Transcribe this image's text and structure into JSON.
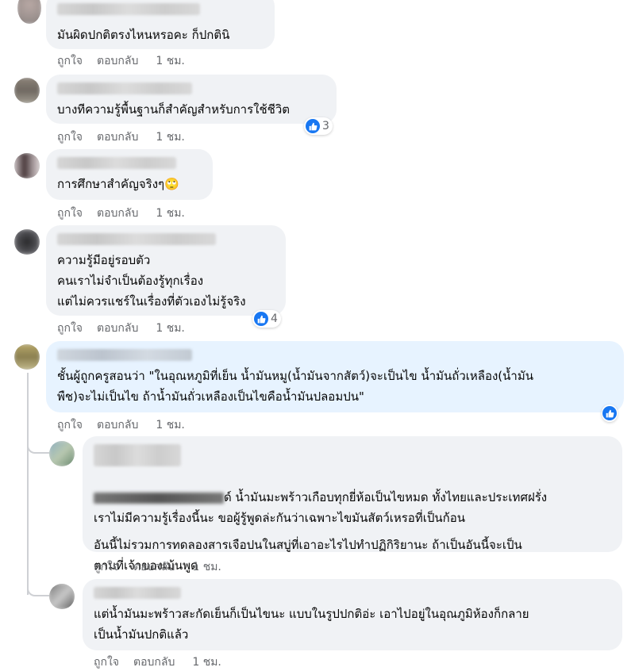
{
  "actions": {
    "like": "ถูกใจ",
    "reply": "ตอบกลับ",
    "time": "1 ชม."
  },
  "colors": {
    "bubble": "#f0f2f5",
    "highlight_bubble": "#e7f3ff",
    "like_blue": "#1877f2",
    "meta_gray": "#65676b"
  },
  "comments": [
    {
      "text": "มันผิดปกติตรงไหนหรอคะ ก็ปกตินิ"
    },
    {
      "text": "บางทีความรู้พื้นฐานก็สำคัญสำหรับการใช้ชีวิต",
      "reactions": "3"
    },
    {
      "text": "การศึกษาสำคัญจริงๆ",
      "emoji": "🙄"
    },
    {
      "text": "ความรู้มีอยู่รอบตัว\nคนเราไม่จำเป็นต้องรู้ทุกเรื่อง\nแต่ไม่ควรแชร์ในเรื่องที่ตัวเองไม่รู้จริง",
      "reactions": "4"
    },
    {
      "text": "ชั้นผู้ถูกครูสอนว่า \"ในอุณหภูมิที่เย็น น้ำมันหมู(น้ำมันจากสัตว์)จะเป็นไข น้ำมันถั่วเหลือง(น้ำมัน\nพืช)จะไม่เป็นไข ถ้าน้ำมันถั่วเหลืองเป็นไขคือน้ำมันปลอมปน\""
    },
    {
      "text_line1_suffix": "ด์ น้ำมันมะพร้าวเกือบทุกยี่ห้อเป็นไขหมด ทั้งไทยและประเทศฝรั่ง",
      "text_line2": "เราไม่มีความรู้เรื่องนี้นะ ขอผู้รู้พูดล่ะกันว่าเฉพาะไขมันสัตว์เหรอที่เป็นก้อน",
      "text_para2": "อันนี้ไม่รวมการทดลองสารเจือปนในสบู่ที่เอาอะไรไปทำปฏิกิริยานะ ถ้าเป็นอันนี้จะเป็น\nตามที่เจ้าของเม้นพูด"
    },
    {
      "text": "แต่น้ำมันมะพร้าวสะกัดเย็นก็เป็นไขนะ แบบในรูปปกติอ่ะ เอาไปอยู่ในอุณภูมิห้องก็กลาย\nเป็นน้ำมันปกติแล้ว"
    }
  ]
}
